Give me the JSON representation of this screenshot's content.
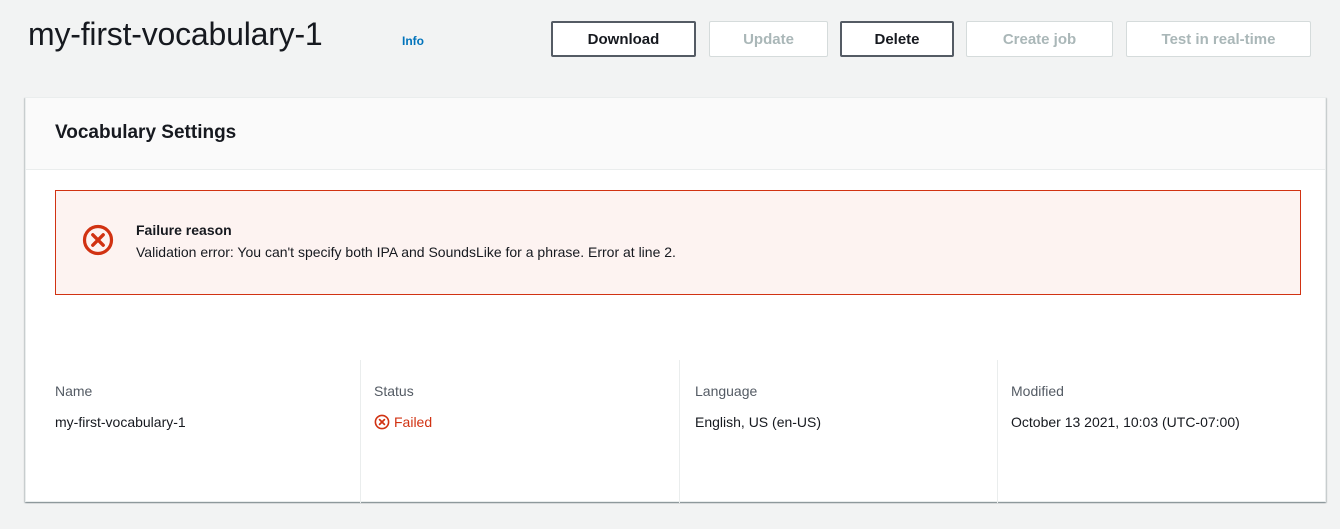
{
  "header": {
    "title": "my-first-vocabulary-1",
    "info_label": "Info",
    "buttons": {
      "download": "Download",
      "update": "Update",
      "delete": "Delete",
      "create_job": "Create job",
      "test_realtime": "Test in real-time"
    }
  },
  "settings": {
    "title": "Vocabulary Settings",
    "alert": {
      "icon": "error-x-circle-icon",
      "title": "Failure reason",
      "message": "Validation error: You can't specify both IPA and SoundsLike for a phrase. Error at line 2."
    },
    "details": {
      "name": {
        "label": "Name",
        "value": "my-first-vocabulary-1"
      },
      "status": {
        "label": "Status",
        "value": "Failed",
        "icon": "error-x-circle-icon"
      },
      "language": {
        "label": "Language",
        "value": "English, US (en-US)"
      },
      "modified": {
        "label": "Modified",
        "value": "October 13 2021, 10:03 (UTC-07:00)"
      }
    }
  },
  "colors": {
    "error": "#d13212",
    "link": "#0073bb",
    "alert_background": "#fdf3f1"
  }
}
